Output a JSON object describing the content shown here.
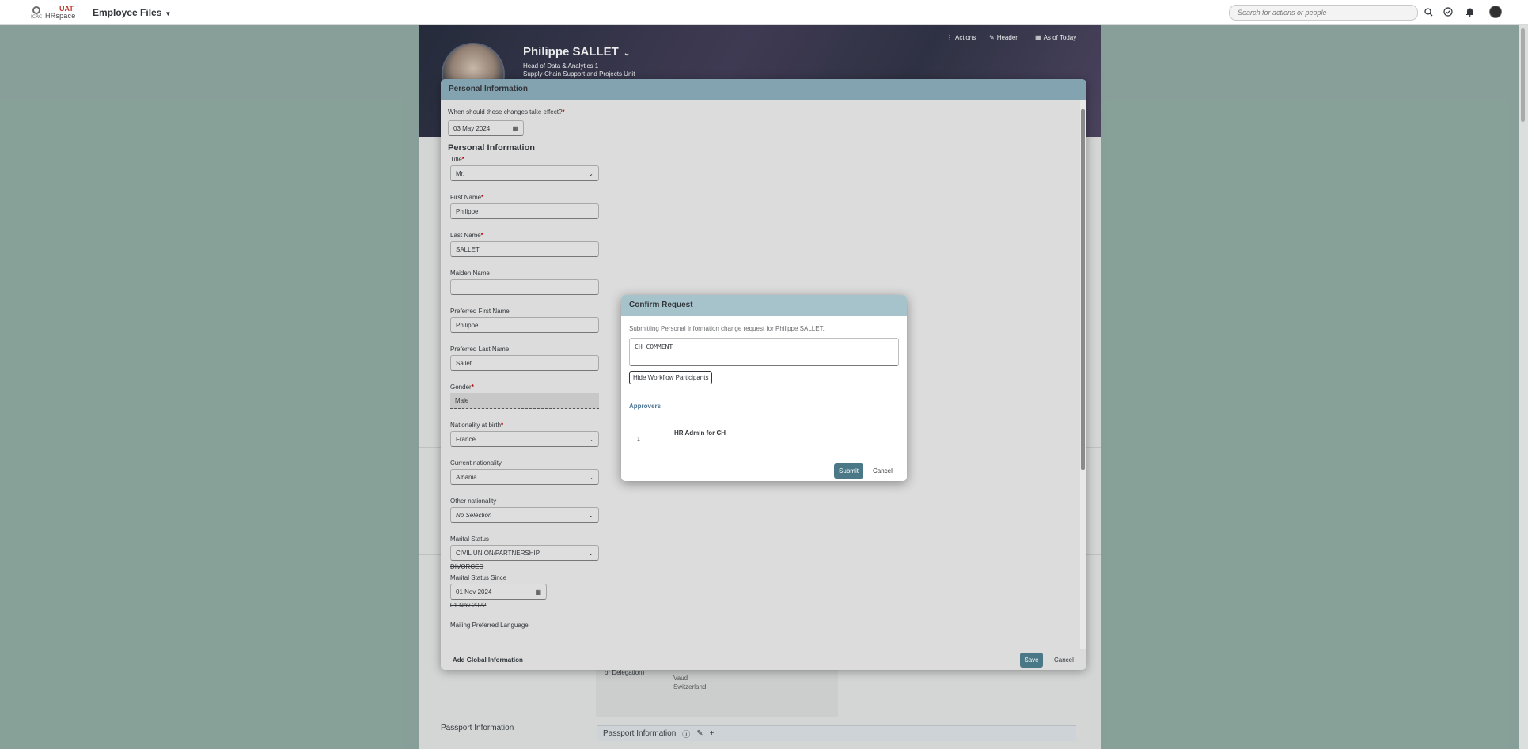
{
  "shell": {
    "logo_text": "HRspace",
    "logo_small": "ICRC",
    "env_badge": "UAT",
    "app_title": "Employee Files",
    "search_placeholder": "Search for actions or people"
  },
  "employee": {
    "name": "Philippe SALLET",
    "role": "Head of Data & Analytics 1",
    "unit": "Supply-Chain Support and Projects Unit"
  },
  "banner_actions": {
    "actions": "Actions",
    "header": "Header",
    "as_of_today": "As of Today"
  },
  "background": {
    "address_label": "or Delegation)",
    "address_lines": [
      "Vaud",
      "Switzerland"
    ],
    "passport_left": "Passport Information",
    "passport_section": "Passport Information"
  },
  "personal_info_dialog": {
    "title": "Personal Information",
    "effective_question": "When should these changes take effect?",
    "effective_date": "03 May 2024",
    "section_title": "Personal Information",
    "fields": {
      "title": {
        "label": "Title",
        "value": "Mr."
      },
      "first_name": {
        "label": "First Name",
        "value": "Philippe"
      },
      "last_name": {
        "label": "Last Name",
        "value": "SALLET"
      },
      "maiden_name": {
        "label": "Maiden Name",
        "value": ""
      },
      "preferred_first_name": {
        "label": "Preferred First Name",
        "value": "Philippe"
      },
      "preferred_last_name": {
        "label": "Preferred Last Name",
        "value": "Sallet"
      },
      "gender": {
        "label": "Gender",
        "value": "Male"
      },
      "nationality_at_birth": {
        "label": "Nationality at birth",
        "value": "France"
      },
      "current_nationality": {
        "label": "Current nationality",
        "value": "Albania"
      },
      "other_nationality": {
        "label": "Other nationality",
        "value": "No Selection"
      },
      "marital_status": {
        "label": "Marital Status",
        "value": "CIVIL UNION/PARTNERSHIP",
        "previous": "DIVORCED"
      },
      "marital_status_since": {
        "label": "Marital Status Since",
        "value": "01 Nov 2024",
        "previous": "01 Nov 2022"
      },
      "mailing_language": {
        "label": "Mailing Preferred Language"
      }
    },
    "footer": {
      "add_global": "Add Global Information",
      "save": "Save",
      "cancel": "Cancel"
    }
  },
  "confirm_dialog": {
    "title": "Confirm Request",
    "description": "Submitting Personal Information change request for Philippe SALLET.",
    "comment": "CH COMMENT",
    "toggle_label": "Hide Workflow Participants",
    "approvers_label": "Approvers",
    "approvers": [
      {
        "step": "1",
        "role": "HR Admin for CH"
      }
    ],
    "submit": "Submit",
    "cancel": "Cancel"
  },
  "colors": {
    "accent": "#4a7886",
    "dialog_header": "#84a3b0",
    "confirm_header": "#a6c3cc",
    "required": "#bb0000",
    "desktop_bg": "#8fa8a0"
  }
}
